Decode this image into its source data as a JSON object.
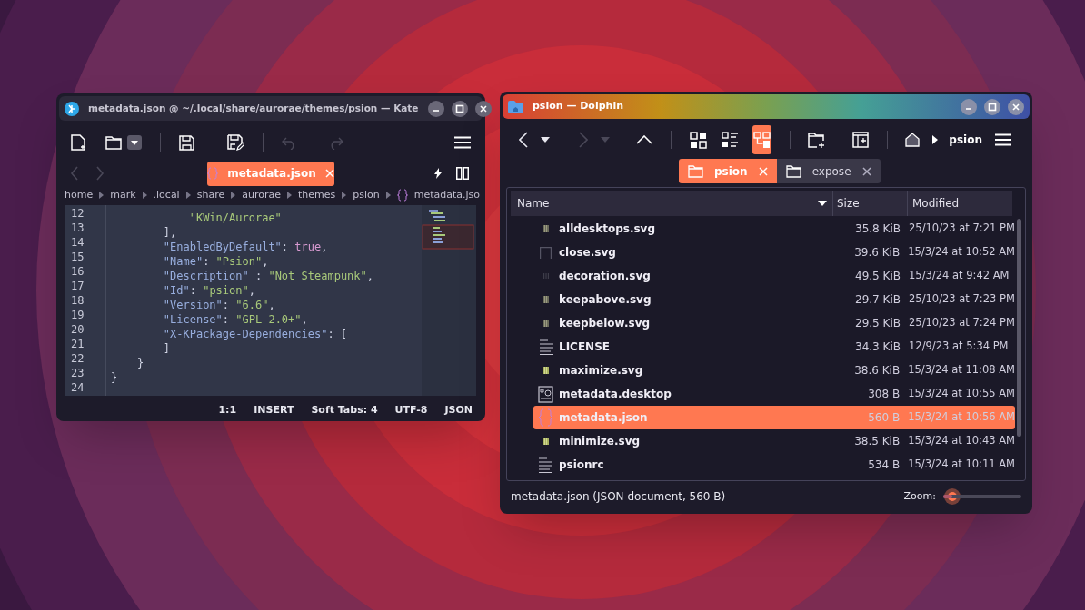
{
  "kate": {
    "title": "metadata.json @ ~/.local/share/aurorae/themes/psion — Kate",
    "toolbar": {
      "undo_enabled": false,
      "redo_enabled": false
    },
    "nav": {
      "back_enabled": false,
      "forward_enabled": false
    },
    "tabs": [
      {
        "label": "metadata.json",
        "selected": true
      }
    ],
    "breadcrumb": [
      "home",
      "mark",
      ".local",
      "share",
      "aurorae",
      "themes",
      "psion",
      "metadata.jso"
    ],
    "code": [
      {
        "number": "12",
        "tokens": [
          {
            "kind": "string",
            "text": "            \"KWin/Aurorae\""
          }
        ]
      },
      {
        "number": "13",
        "tokens": [
          {
            "kind": "plain",
            "text": "        ],"
          }
        ]
      },
      {
        "number": "14",
        "tokens": [
          {
            "kind": "key",
            "text": "        \"EnabledByDefault\""
          },
          {
            "kind": "plain",
            "text": ": "
          },
          {
            "kind": "bool",
            "text": "true"
          },
          {
            "kind": "plain",
            "text": ","
          }
        ]
      },
      {
        "number": "15",
        "tokens": [
          {
            "kind": "key",
            "text": "        \"Name\""
          },
          {
            "kind": "plain",
            "text": ": "
          },
          {
            "kind": "string",
            "text": "\"Psion\""
          },
          {
            "kind": "plain",
            "text": ","
          }
        ]
      },
      {
        "number": "16",
        "tokens": [
          {
            "kind": "key",
            "text": "        \"Description\""
          },
          {
            "kind": "plain",
            "text": " : "
          },
          {
            "kind": "string",
            "text": "\"Not Steampunk\""
          },
          {
            "kind": "plain",
            "text": ","
          }
        ]
      },
      {
        "number": "17",
        "tokens": [
          {
            "kind": "key",
            "text": "        \"Id\""
          },
          {
            "kind": "plain",
            "text": ": "
          },
          {
            "kind": "string",
            "text": "\"psion\""
          },
          {
            "kind": "plain",
            "text": ","
          }
        ]
      },
      {
        "number": "18",
        "tokens": [
          {
            "kind": "key",
            "text": "        \"Version\""
          },
          {
            "kind": "plain",
            "text": ": "
          },
          {
            "kind": "string",
            "text": "\"6.6\""
          },
          {
            "kind": "plain",
            "text": ","
          }
        ]
      },
      {
        "number": "19",
        "tokens": [
          {
            "kind": "key",
            "text": "        \"License\""
          },
          {
            "kind": "plain",
            "text": ": "
          },
          {
            "kind": "string",
            "text": "\"GPL-2.0+\""
          },
          {
            "kind": "plain",
            "text": ","
          }
        ]
      },
      {
        "number": "20",
        "tokens": [
          {
            "kind": "key",
            "text": "        \"X-KPackage-Dependencies\""
          },
          {
            "kind": "plain",
            "text": ": ["
          }
        ]
      },
      {
        "number": "21",
        "tokens": [
          {
            "kind": "plain",
            "text": "        ]"
          }
        ]
      },
      {
        "number": "22",
        "tokens": [
          {
            "kind": "plain",
            "text": "    }"
          }
        ]
      },
      {
        "number": "23",
        "tokens": [
          {
            "kind": "plain",
            "text": "}"
          }
        ]
      },
      {
        "number": "24"
      }
    ],
    "status_bar": [
      "1:1",
      "INSERT",
      "Soft Tabs: 4",
      "UTF-8",
      "JSON"
    ]
  },
  "dolphin": {
    "title": "psion — Dolphin",
    "nav": {
      "back_enabled": true,
      "forward_enabled": false
    },
    "view_buttons": [
      {
        "kind": "icons",
        "selected": false
      },
      {
        "kind": "details",
        "selected": false
      },
      {
        "kind": "split",
        "selected": true
      }
    ],
    "location": "psion",
    "tabs": [
      {
        "label": "psion",
        "selected": true
      },
      {
        "label": "expose",
        "selected": false
      }
    ],
    "columns": [
      "Name",
      "Size",
      "Modified"
    ],
    "rows": [
      {
        "kind": "svg",
        "name": "alldesktops.svg",
        "size": "35.8 KiB",
        "modified": "25/10/23 at 7:21 PM",
        "selected": false
      },
      {
        "kind": "outline",
        "name": "close.svg",
        "size": "39.6 KiB",
        "modified": "15/3/24 at 10:52 AM",
        "selected": false
      },
      {
        "kind": "faint",
        "name": "decoration.svg",
        "size": "49.5 KiB",
        "modified": "15/3/24 at 9:42 AM",
        "selected": false
      },
      {
        "kind": "svg",
        "name": "keepabove.svg",
        "size": "29.7 KiB",
        "modified": "25/10/23 at 7:23 PM",
        "selected": false
      },
      {
        "kind": "svg",
        "name": "keepbelow.svg",
        "size": "29.5 KiB",
        "modified": "25/10/23 at 7:24 PM",
        "selected": false
      },
      {
        "kind": "text",
        "name": "LICENSE",
        "size": "34.3 KiB",
        "modified": "12/9/23 at 5:34 PM",
        "selected": false
      },
      {
        "kind": "green",
        "name": "maximize.svg",
        "size": "38.6 KiB",
        "modified": "15/3/24 at 11:08 AM",
        "selected": false
      },
      {
        "kind": "desktop",
        "name": "metadata.desktop",
        "size": "308 B",
        "modified": "15/3/24 at 10:55 AM",
        "selected": false
      },
      {
        "kind": "json",
        "name": "metadata.json",
        "size": "560 B",
        "modified": "15/3/24 at 10:56 AM",
        "selected": true
      },
      {
        "kind": "green",
        "name": "minimize.svg",
        "size": "38.5 KiB",
        "modified": "15/3/24 at 10:43 AM",
        "selected": false
      },
      {
        "kind": "text",
        "name": "psionrc",
        "size": "534 B",
        "modified": "15/3/24 at 10:11 AM",
        "selected": false
      }
    ],
    "status_text": "metadata.json (JSON document, 560 B)",
    "zoom": {
      "label": "Zoom:",
      "level": 0.12
    }
  }
}
